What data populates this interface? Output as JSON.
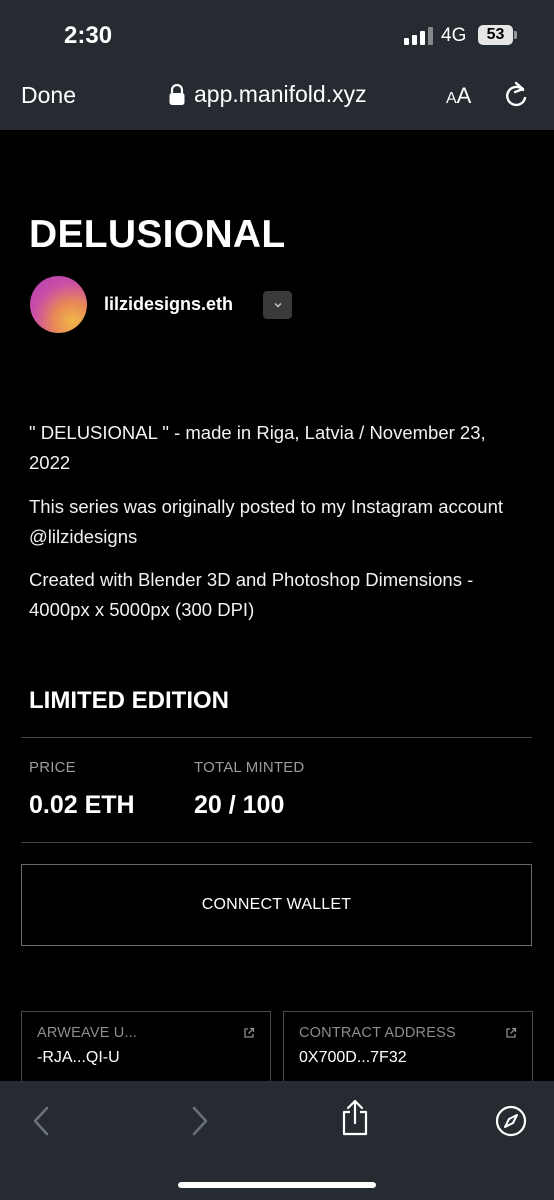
{
  "status_bar": {
    "time": "2:30",
    "network": "4G",
    "battery": "53"
  },
  "browser": {
    "done_label": "Done",
    "url": "app.manifold.xyz",
    "text_size_small": "A",
    "text_size_large": "A"
  },
  "page": {
    "title": "DELUSIONAL",
    "creator": "lilzidesigns.eth",
    "description": [
      "\" DELUSIONAL \" - made in Riga, Latvia / November 23, 2022",
      "This series was originally posted to my Instagram account @lilzidesigns",
      "Created with Blender 3D and Photoshop Dimensions - 4000px x 5000px (300 DPI)"
    ],
    "edition_heading": "LIMITED EDITION",
    "price_label": "PRICE",
    "price_value": "0.02 ETH",
    "minted_label": "TOTAL MINTED",
    "minted_value": "20 / 100",
    "connect_label": "CONNECT WALLET",
    "arweave_label": "ARWEAVE U...",
    "arweave_value": "-RJA...QI-U",
    "contract_label": "CONTRACT ADDRESS",
    "contract_value": "0X700D...7F32"
  },
  "colors": {
    "chrome_bg": "#262b32",
    "page_bg": "#000000",
    "muted_text": "#9b9b9b"
  }
}
